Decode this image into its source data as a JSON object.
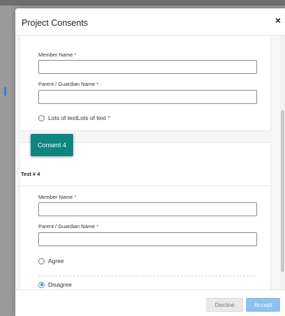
{
  "modal": {
    "title": "Project Consents",
    "close_glyph": "×"
  },
  "consent_3": {
    "member_name_label": "Member Name",
    "parent_guardian_label": "Parent / Guardian Name",
    "required_marker": "*",
    "option_label": "Lots of textLots of text",
    "option_selected": false
  },
  "consent_4": {
    "tab_label": "Consent 4",
    "title": "Test # 4",
    "member_name_label": "Member Name",
    "parent_guardian_label": "Parent / Guardian Name",
    "required_marker": "*",
    "options": [
      {
        "label": "Agree",
        "selected": false
      },
      {
        "label": "Disagree",
        "selected": true
      }
    ]
  },
  "footer": {
    "decline_label": "Decline",
    "accept_label": "Accept"
  },
  "colors": {
    "accent_teal": "#0f8583",
    "required_red": "#d9262c",
    "radio_blue": "#4a90e2",
    "accept_disabled": "#8fc0ee"
  },
  "icons": {
    "close": "close-icon",
    "radio": "radio-icon"
  }
}
